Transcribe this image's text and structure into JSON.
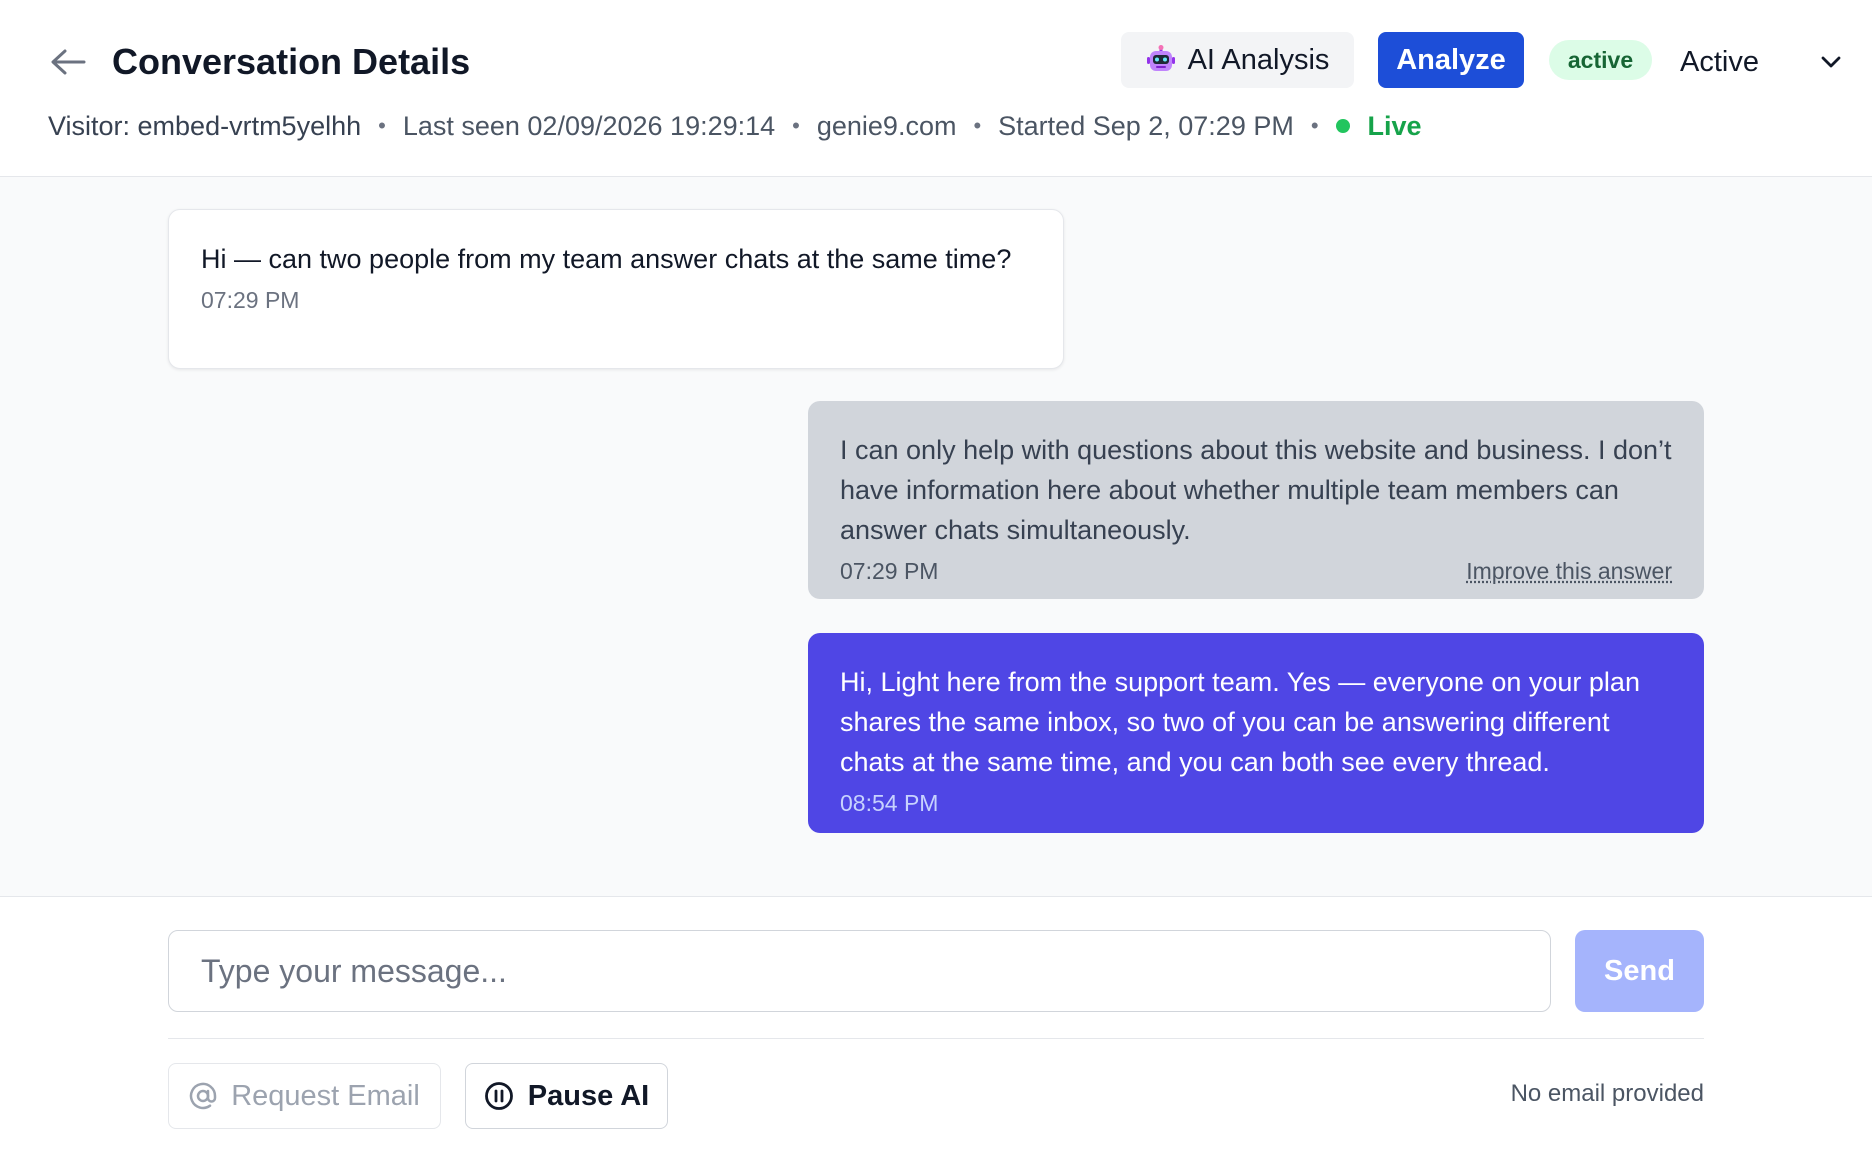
{
  "header": {
    "title": "Conversation Details",
    "ai_analysis_label": "AI Analysis",
    "analyze_label": "Analyze",
    "status_badge": "active",
    "status_select_value": "Active",
    "meta": {
      "visitor": "Visitor: embed-vrtm5yelhh",
      "last_seen": "Last seen 02/09/2026 19:29:14",
      "domain": "genie9.com",
      "started": "Started Sep 2, 07:29 PM",
      "live": "Live",
      "separator": "•"
    }
  },
  "messages": [
    {
      "role": "visitor",
      "text": "Hi — can two people from my team answer chats at the same time?",
      "time": "07:29 PM"
    },
    {
      "role": "ai",
      "text": "I can only help with questions about this website and business. I don’t have information here about whether multiple team members can answer chats simultaneously.",
      "time": "07:29 PM",
      "improve_label": "Improve this answer"
    },
    {
      "role": "agent",
      "text": "Hi, Light here from the support team. Yes — everyone on your plan shares the same inbox, so two of you can be answering different chats at the same time, and you can both see every thread.",
      "time": "08:54 PM"
    }
  ],
  "composer": {
    "placeholder": "Type your message...",
    "value": "",
    "send_label": "Send",
    "request_email_label": "Request Email",
    "pause_ai_label": "Pause AI",
    "email_status": "No email provided"
  },
  "colors": {
    "primary": "#1d4ed8",
    "agent_bubble": "#4f46e5",
    "ai_bubble": "#d1d5db",
    "live": "#22c55e",
    "send_disabled": "#a5b4fc"
  },
  "icons": {
    "back": "arrow-left-icon",
    "ai_analysis": "robot-icon",
    "status_select": "chevron-down-icon",
    "request_email": "at-sign-icon",
    "pause_ai": "pause-circle-icon"
  }
}
